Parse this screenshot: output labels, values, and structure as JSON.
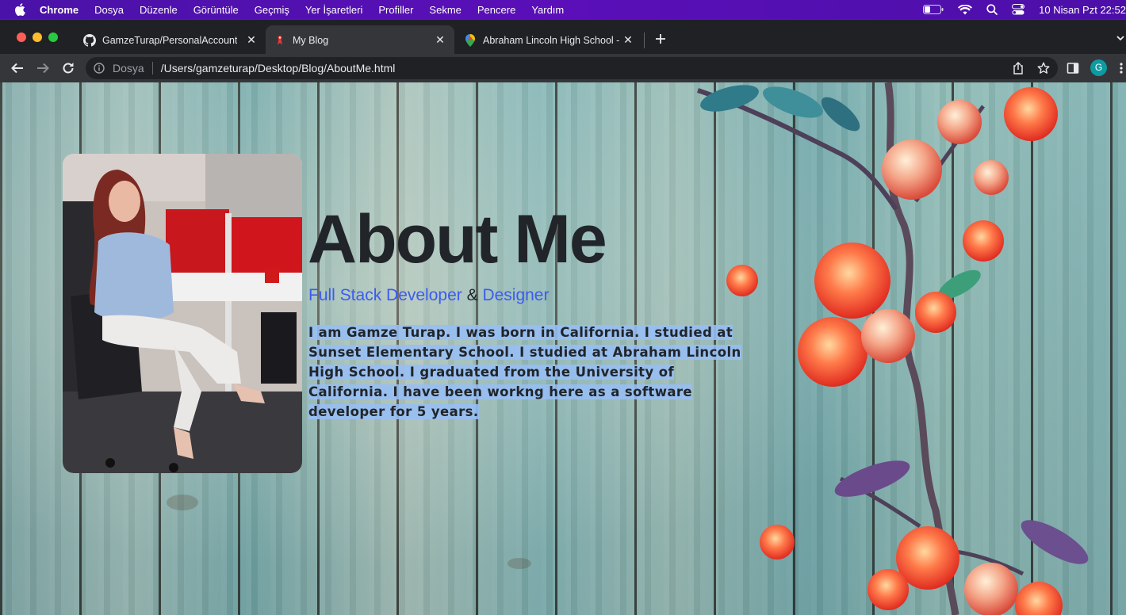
{
  "menubar": {
    "apple_icon": "apple-icon",
    "items": [
      "Chrome",
      "Dosya",
      "Düzenle",
      "Görüntüle",
      "Geçmiş",
      "Yer İşaretleri",
      "Profiller",
      "Sekme",
      "Pencere",
      "Yardım"
    ],
    "status_icons": [
      "battery-icon",
      "wifi-icon",
      "search-icon",
      "control-center-icon"
    ],
    "clock": "10 Nisan Pzt  22:52"
  },
  "tabs": [
    {
      "title": "GamzeTurap/PersonalAccount",
      "icon": "github-icon",
      "active": false
    },
    {
      "title": "My Blog",
      "icon": "blog-favicon-icon",
      "active": true
    },
    {
      "title": "Abraham Lincoln High School -",
      "icon": "maps-pin-icon",
      "active": false
    }
  ],
  "toolbar": {
    "scheme_label": "Dosya",
    "url": "/Users/gamzeturap/Desktop/Blog/AboutMe.html",
    "profile_initial": "G"
  },
  "page": {
    "heading": "About Me",
    "role1": "Full Stack Developer",
    "amp": " & ",
    "role2": "Designer",
    "bio_lines": [
      "I am Gamze Turap. I was born in California. I studied at",
      "Sunset Elementary School. I studied at Abraham Lincoln",
      "High School. I graduated from the University of",
      "California. I have been workng here as a software",
      "developer for 5 years."
    ]
  },
  "colors": {
    "menubar": "#4a12a8",
    "tabstrip": "#202124",
    "toolbar": "#35363a",
    "role_link": "#3b5bf1",
    "heading": "#212529",
    "selection": "#96bef5"
  }
}
